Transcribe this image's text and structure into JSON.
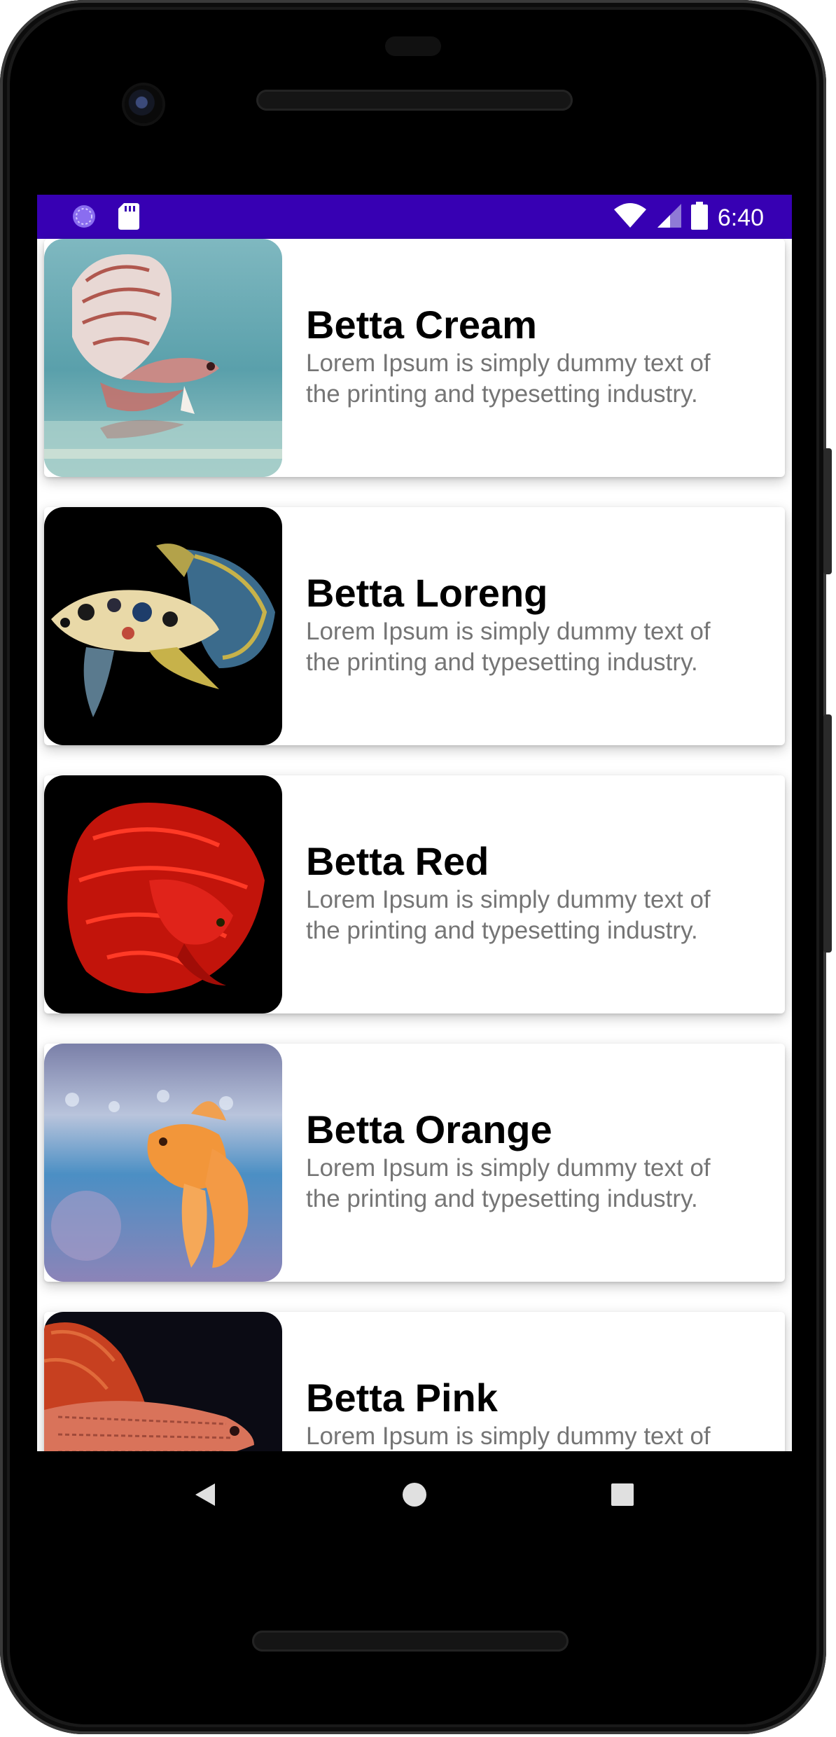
{
  "status_bar": {
    "time": "6:40",
    "background": "#3700b3",
    "left_icons": [
      "sync-icon",
      "sd-card-icon"
    ],
    "right_icons": [
      "wifi-icon",
      "signal-icon",
      "battery-icon"
    ]
  },
  "items": [
    {
      "title": "Betta Cream",
      "description": "Lorem Ipsum is simply dummy text of the printing and typesetting industry.",
      "image": "betta-cream-image"
    },
    {
      "title": "Betta Loreng",
      "description": "Lorem Ipsum is simply dummy text of the printing and typesetting industry.",
      "image": "betta-loreng-image"
    },
    {
      "title": "Betta Red",
      "description": "Lorem Ipsum is simply dummy text of the printing and typesetting industry.",
      "image": "betta-red-image"
    },
    {
      "title": "Betta Orange",
      "description": "Lorem Ipsum is simply dummy text of the printing and typesetting industry.",
      "image": "betta-orange-image"
    },
    {
      "title": "Betta Pink",
      "description": "Lorem Ipsum is simply dummy text of the printing and typesetting industry.",
      "image": "betta-pink-image"
    }
  ],
  "nav_bar": {
    "buttons": [
      "back-icon",
      "home-icon",
      "recents-icon"
    ]
  }
}
